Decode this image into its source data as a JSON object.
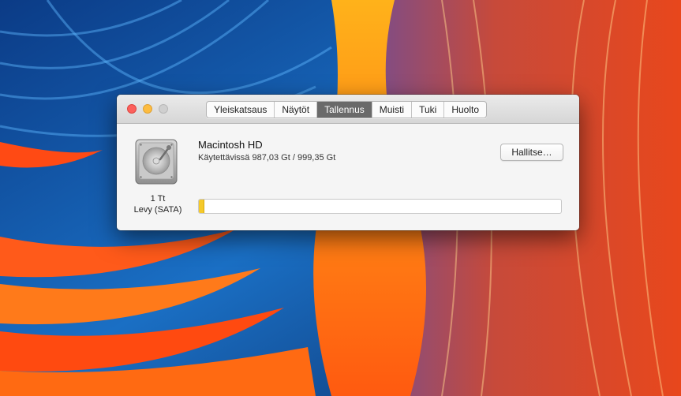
{
  "window": {
    "tabs": [
      {
        "label": "Yleiskatsaus",
        "active": false
      },
      {
        "label": "Näytöt",
        "active": false
      },
      {
        "label": "Tallennus",
        "active": true
      },
      {
        "label": "Muisti",
        "active": false
      },
      {
        "label": "Tuki",
        "active": false
      },
      {
        "label": "Huolto",
        "active": false
      }
    ]
  },
  "storage": {
    "disk_size": "1 Tt",
    "disk_type": "Levy (SATA)",
    "volume_name": "Macintosh HD",
    "available_text": "Käytettävissä 987,03 Gt / 999,35 Gt",
    "manage_label": "Hallitse…",
    "used_fraction": 0.0123,
    "used_color": "#f5c92a"
  },
  "colors": {
    "close": "#fc605c",
    "minimize": "#fdbc40",
    "active_tab": "#6a6a6a"
  }
}
